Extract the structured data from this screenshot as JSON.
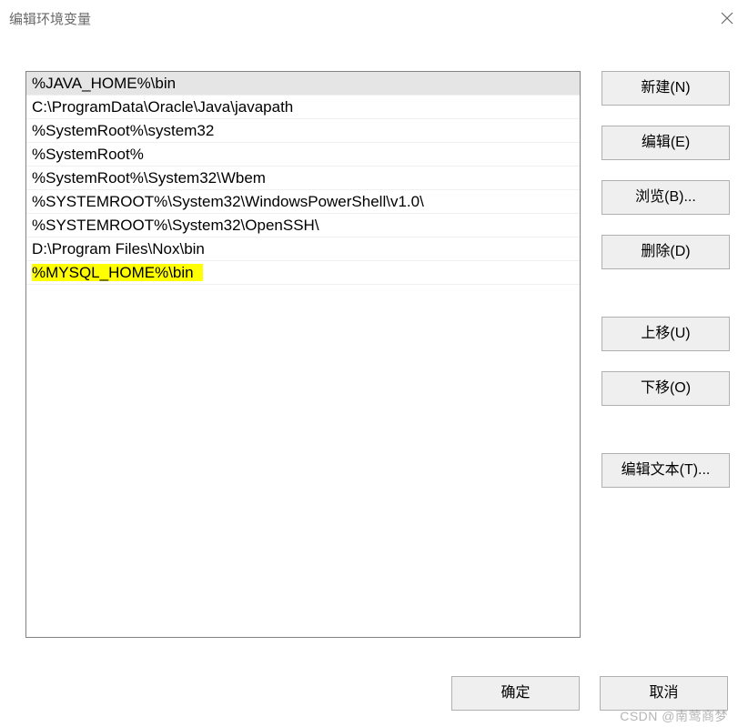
{
  "window": {
    "title": "编辑环境变量"
  },
  "list": {
    "items": [
      {
        "text": "%JAVA_HOME%\\bin",
        "selected": true,
        "highlight": false
      },
      {
        "text": "C:\\ProgramData\\Oracle\\Java\\javapath",
        "selected": false,
        "highlight": false
      },
      {
        "text": "%SystemRoot%\\system32",
        "selected": false,
        "highlight": false
      },
      {
        "text": "%SystemRoot%",
        "selected": false,
        "highlight": false
      },
      {
        "text": "%SystemRoot%\\System32\\Wbem",
        "selected": false,
        "highlight": false
      },
      {
        "text": "%SYSTEMROOT%\\System32\\WindowsPowerShell\\v1.0\\",
        "selected": false,
        "highlight": false
      },
      {
        "text": "%SYSTEMROOT%\\System32\\OpenSSH\\",
        "selected": false,
        "highlight": false
      },
      {
        "text": "D:\\Program Files\\Nox\\bin",
        "selected": false,
        "highlight": false
      },
      {
        "text": "%MYSQL_HOME%\\bin",
        "selected": false,
        "highlight": true
      }
    ]
  },
  "buttons": {
    "new": "新建(N)",
    "edit": "编辑(E)",
    "browse": "浏览(B)...",
    "delete": "删除(D)",
    "move_up": "上移(U)",
    "move_down": "下移(O)",
    "edit_text": "编辑文本(T)...",
    "ok": "确定",
    "cancel": "取消"
  },
  "watermark": "CSDN @南莺商梦"
}
